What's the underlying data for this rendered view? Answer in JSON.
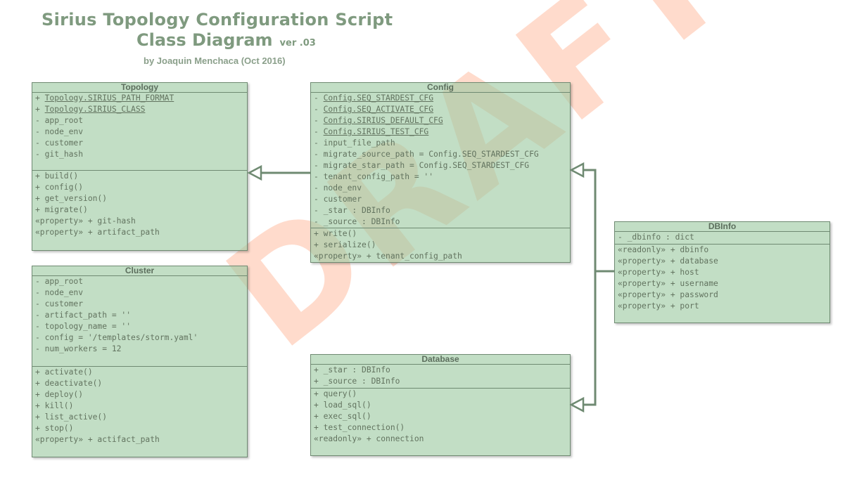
{
  "title": {
    "line1": "Sirius Topology Configuration Script",
    "line2": "Class Diagram",
    "version": "ver .03",
    "author": "by Joaquin Menchaca (Oct 2016)"
  },
  "watermark": "DRAFT",
  "colors": {
    "class_fill": "#9dc9a1",
    "border": "#6f8a72",
    "watermark": "#ffa27c",
    "title": "#7f9a7f"
  },
  "classes": {
    "topology": {
      "name": "Topology",
      "attributes": [
        {
          "prefix": "+ ",
          "text": "Topology.SIRIUS_PATH_FORMAT",
          "static": true
        },
        {
          "prefix": "+ ",
          "text": "Topology.SIRIUS_CLASS",
          "static": true
        },
        {
          "prefix": "- ",
          "text": "app_root",
          "static": false
        },
        {
          "prefix": "- ",
          "text": "node_env",
          "static": false
        },
        {
          "prefix": "- ",
          "text": "customer",
          "static": false
        },
        {
          "prefix": "- ",
          "text": "git_hash",
          "static": false
        }
      ],
      "methods": [
        "+ build()",
        "+ config()",
        "+ get_version()",
        "+ migrate()",
        "«property» + git-hash",
        "«property» + artifact_path"
      ]
    },
    "config": {
      "name": "Config",
      "attributes": [
        {
          "prefix": "- ",
          "text": "Config.SEQ_STARDEST_CFG",
          "static": true
        },
        {
          "prefix": "- ",
          "text": "Config.SEQ_ACTIVATE_CFG",
          "static": true
        },
        {
          "prefix": "- ",
          "text": "Config.SIRIUS_DEFAULT_CFG",
          "static": true
        },
        {
          "prefix": "- ",
          "text": "Config.SIRIUS_TEST_CFG",
          "static": true
        },
        {
          "prefix": "- ",
          "text": "input_file_path",
          "static": false
        },
        {
          "prefix": "- ",
          "text": "migrate_source_path = Config.SEQ_STARDEST_CFG",
          "static": false
        },
        {
          "prefix": "- ",
          "text": "migrate_star_path = Config.SEQ_STARDEST_CFG",
          "static": false
        },
        {
          "prefix": "- ",
          "text": "tenant_config_path = ''",
          "static": false
        },
        {
          "prefix": "- ",
          "text": "node_env",
          "static": false
        },
        {
          "prefix": "- ",
          "text": "customer",
          "static": false
        },
        {
          "prefix": "- ",
          "text": "_star : DBInfo",
          "static": false
        },
        {
          "prefix": "- ",
          "text": "_source : DBInfo",
          "static": false
        }
      ],
      "methods": [
        "+ write()",
        "+ serialize()",
        "«property» + tenant_config_path"
      ]
    },
    "cluster": {
      "name": "Cluster",
      "attributes": [
        {
          "prefix": "- ",
          "text": "app_root",
          "static": false
        },
        {
          "prefix": "- ",
          "text": "node_env",
          "static": false
        },
        {
          "prefix": "- ",
          "text": "customer",
          "static": false
        },
        {
          "prefix": "- ",
          "text": "artifact_path = ''",
          "static": false
        },
        {
          "prefix": "- ",
          "text": "topology_name = ''",
          "static": false
        },
        {
          "prefix": "- ",
          "text": "config = '/templates/storm.yaml'",
          "static": false
        },
        {
          "prefix": "- ",
          "text": "num_workers = 12",
          "static": false
        }
      ],
      "methods": [
        "+ activate()",
        "+ deactivate()",
        "+ deploy()",
        "+ kill()",
        "+ list_active()",
        "+ stop()",
        "«property» + actifact_path"
      ]
    },
    "database": {
      "name": "Database",
      "attributes": [
        {
          "prefix": "+ ",
          "text": "_star : DBInfo",
          "static": false
        },
        {
          "prefix": "+ ",
          "text": "_source : DBInfo",
          "static": false
        }
      ],
      "methods": [
        "+ query()",
        "+ load_sql()",
        "+ exec_sql()",
        "+ test_connection()",
        "«readonly» + connection"
      ]
    },
    "dbinfo": {
      "name": "DBInfo",
      "attributes": [
        {
          "prefix": "- ",
          "text": "_dbinfo : dict",
          "static": false
        }
      ],
      "methods": [
        "«readonly» + dbinfo",
        "«property» + database",
        "«property» + host",
        "«property» + username",
        "«property» + password",
        "«property» + port"
      ]
    }
  }
}
